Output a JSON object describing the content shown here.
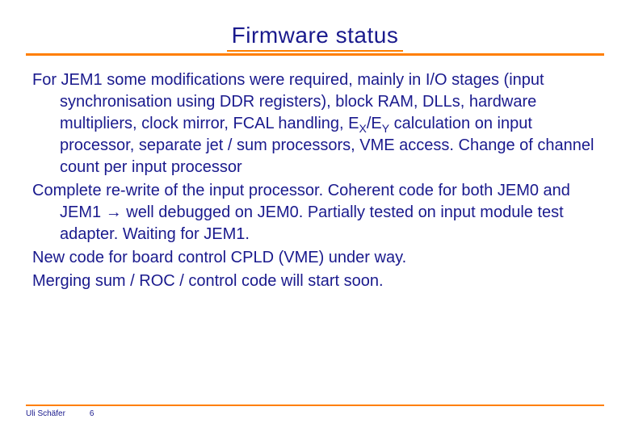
{
  "title": "Firmware status",
  "paragraphs": {
    "p1_a": "For JEM1 some modifications were required, mainly in I/O stages (input synchronisation using DDR registers), block RAM, DLLs, hardware multipliers, clock mirror, FCAL handling, E",
    "p1_subX": "X",
    "p1_b": "/E",
    "p1_subY": "Y",
    "p1_c": " calculation on input processor, separate jet / sum processors, VME access. Change of channel count per input processor",
    "p2_a": "Complete re-write of the input processor. Coherent code for both JEM0 and JEM1 ",
    "p2_arrow": "→",
    "p2_b": " well debugged on JEM0. Partially tested on input module test adapter. Waiting for JEM1.",
    "p3": "New code for board control CPLD (VME) under way.",
    "p4": "Merging sum / ROC / control code will start soon."
  },
  "footer": {
    "author": "Uli Schäfer",
    "page": "6"
  }
}
